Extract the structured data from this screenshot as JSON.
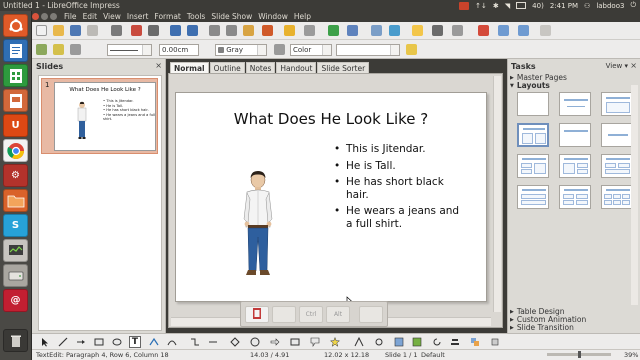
{
  "window": {
    "title": "Untitled 1 - LibreOffice Impress"
  },
  "tray": {
    "volume": "40)",
    "time": "2:41 PM",
    "user": "labdoo3",
    "sort": "↑↓"
  },
  "menu": [
    "File",
    "Edit",
    "View",
    "Insert",
    "Format",
    "Tools",
    "Slide Show",
    "Window",
    "Help"
  ],
  "toolbar2": {
    "width_value": "0.00cm",
    "line_color": "Gray",
    "area_mode": "Color"
  },
  "slides_panel": {
    "title": "Slides",
    "close": "×",
    "slide_number": "1"
  },
  "view_tabs": [
    "Normal",
    "Outline",
    "Notes",
    "Handout",
    "Slide Sorter"
  ],
  "slide": {
    "title": "What Does He Look Like ?",
    "bullets": [
      "This is Jitendar.",
      "He is Tall.",
      "He has short black hair.",
      "He wears a jeans and a full shirt."
    ]
  },
  "float_toolbar": [
    "Ctrl",
    "Alt"
  ],
  "tasks": {
    "title": "Tasks",
    "view_label": "View",
    "sections_top": [
      "Master Pages",
      "Layouts"
    ],
    "sections_bottom": [
      "Table Design",
      "Custom Animation",
      "Slide Transition"
    ],
    "expanded": "Layouts"
  },
  "status": {
    "mode": "TextEdit: Paragraph 4, Row 6, Column 18",
    "position": "14.03 / 4.91",
    "size": "12.02 x 12.18",
    "slide": "Slide 1 / 1",
    "layout": "Default",
    "zoom": "39%"
  },
  "colors": {
    "accent": "#e95420",
    "title_bar": "#3c3b37",
    "selected_slide": "#e8b9a4",
    "layout_highlight": "#6f8fbc"
  }
}
